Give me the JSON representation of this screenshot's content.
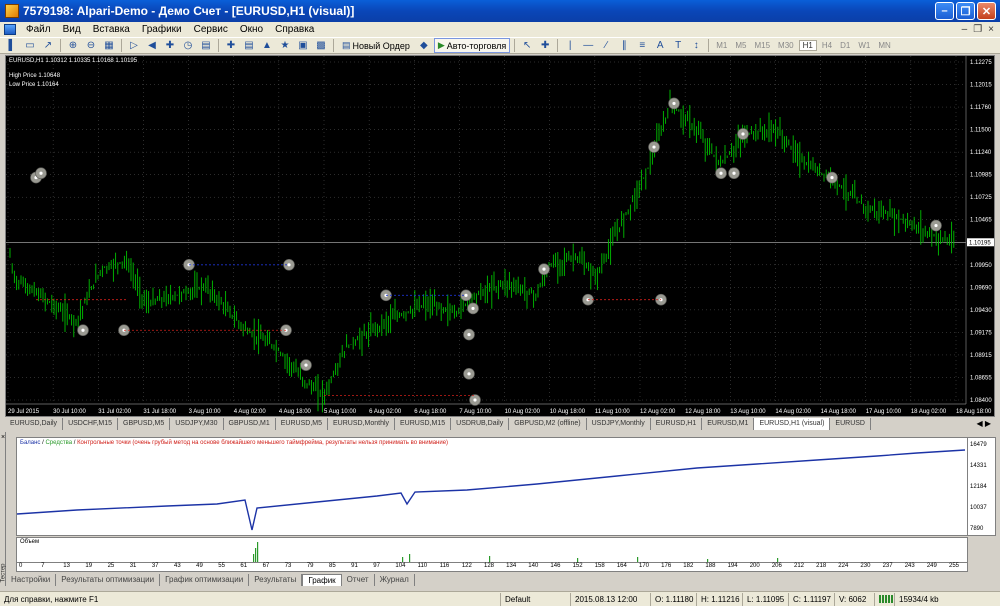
{
  "window": {
    "title": "7579198: Alpari-Demo - Демо Счет - [EURUSD,H1 (visual)]"
  },
  "menu": {
    "items": [
      "Файл",
      "Вид",
      "Вставка",
      "Графики",
      "Сервис",
      "Окно",
      "Справка"
    ]
  },
  "toolbar": {
    "new_order_label": "Новый Ордер",
    "autotrading_label": "Авто-торговля",
    "timeframes": [
      "M1",
      "M5",
      "M15",
      "M30",
      "H1",
      "H4",
      "D1",
      "W1",
      "MN"
    ],
    "active_timeframe": "H1"
  },
  "chart": {
    "header": "EURUSD,H1  1.10312 1.10335 1.10168 1.10195",
    "high_label": "High Price  1.10648",
    "low_label": "Low Price  1.10164",
    "current_price": "1.10195",
    "price_ticks": [
      "1.12275",
      "1.12015",
      "1.11760",
      "1.11500",
      "1.11240",
      "1.10985",
      "1.10725",
      "1.10465",
      "1.10195",
      "1.09950",
      "1.09690",
      "1.09430",
      "1.09175",
      "1.08915",
      "1.08655",
      "1.08400"
    ],
    "time_ticks": [
      "29 Jul 2015",
      "30 Jul 10:00",
      "31 Jul 02:00",
      "31 Jul 18:00",
      "3 Aug 10:00",
      "4 Aug 02:00",
      "4 Aug 18:00",
      "5 Aug 10:00",
      "6 Aug 02:00",
      "6 Aug 18:00",
      "7 Aug 10:00",
      "10 Aug 02:00",
      "10 Aug 18:00",
      "11 Aug 10:00",
      "12 Aug 02:00",
      "12 Aug 18:00",
      "13 Aug 10:00",
      "14 Aug 02:00",
      "14 Aug 18:00",
      "17 Aug 10:00",
      "18 Aug 02:00",
      "18 Aug 18:00"
    ],
    "colors": {
      "background": "#000000",
      "bull": "#00c000",
      "bear": "#00c000",
      "grid": "#5a5a5a",
      "text": "#ffffff"
    }
  },
  "symbol_tabs": [
    "EURUSD,Daily",
    "USDCHF,M15",
    "GBPUSD,M5",
    "USDJPY,M30",
    "GBPUSD,M1",
    "EURUSD,M5",
    "EURUSD,Monthly",
    "EURUSD,M15",
    "USDRUB,Daily",
    "GBPUSD,M2 (offline)",
    "USDJPY,Monthly",
    "EURUSD,H1",
    "EURUSD,M1",
    "EURUSD,H1 (visual)",
    "EURUSD"
  ],
  "active_symbol_tab": 13,
  "tester": {
    "legend_balance": "Баланс",
    "legend_equity": "Средства",
    "legend_checkpoints": "Контрольные точки (очень грубый метод на основе ближайшего меньшего таймфрейма, результаты нельзя принимать во внимание)",
    "volume_label": "Объем",
    "side_label": "Тестер",
    "y_ticks": [
      "16479",
      "14331",
      "12184",
      "10037",
      "7890"
    ],
    "x_ticks": [
      "0",
      "7",
      "13",
      "19",
      "25",
      "31",
      "37",
      "43",
      "49",
      "55",
      "61",
      "67",
      "73",
      "79",
      "85",
      "91",
      "97",
      "104",
      "110",
      "116",
      "122",
      "128",
      "134",
      "140",
      "146",
      "152",
      "158",
      "164",
      "170",
      "176",
      "182",
      "188",
      "194",
      "200",
      "206",
      "212",
      "218",
      "224",
      "230",
      "237",
      "243",
      "249",
      "255"
    ],
    "tabs": [
      "Настройки",
      "Результаты оптимизации",
      "График оптимизации",
      "Результаты",
      "График",
      "Отчет",
      "Журнал"
    ],
    "active_tab": 4
  },
  "status": {
    "help": "Для справки, нажмите F1",
    "profile": "Default",
    "datetime": "2015.08.13 12:00",
    "open": "O: 1.11180",
    "high": "H: 1.11216",
    "low": "L: 1.11095",
    "close": "C: 1.11197",
    "volume": "V: 6062",
    "traffic": "15934/4 kb"
  }
}
